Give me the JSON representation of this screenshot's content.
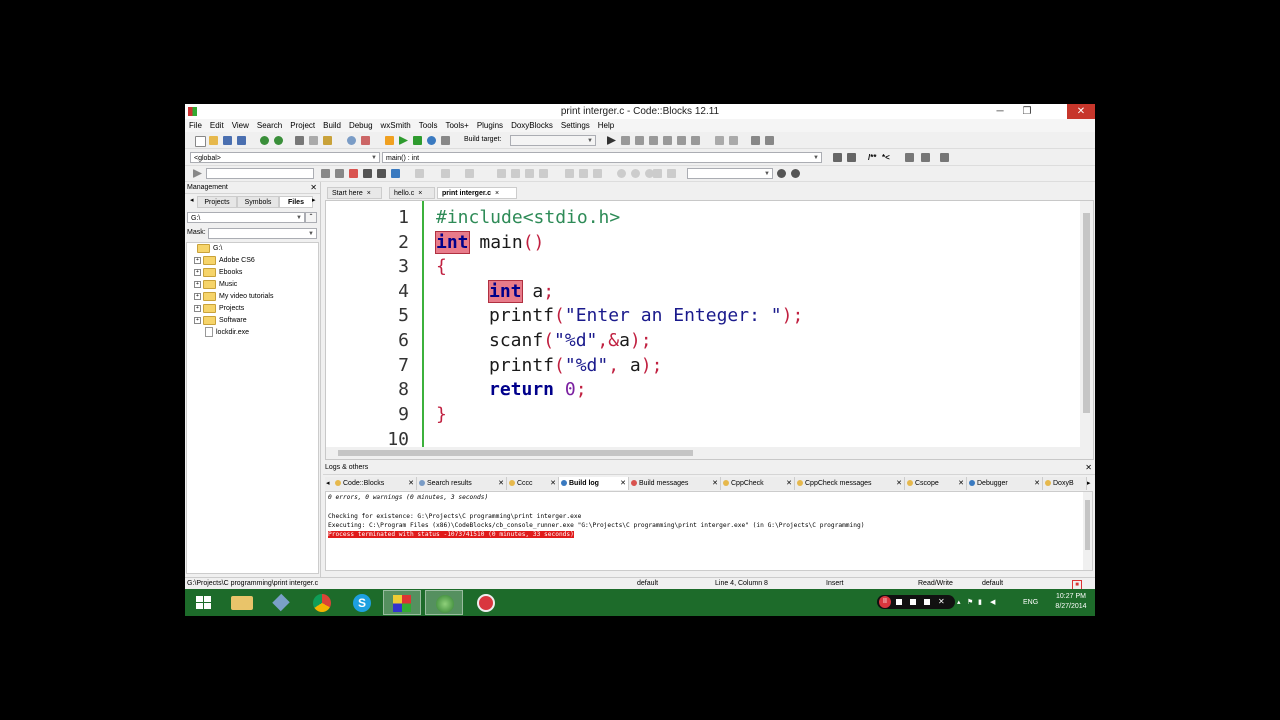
{
  "window": {
    "title": "print interger.c - Code::Blocks 12.11",
    "minimize": "─",
    "maximize": "❐",
    "close": "✕"
  },
  "menu": [
    "File",
    "Edit",
    "View",
    "Search",
    "Project",
    "Build",
    "Debug",
    "wxSmith",
    "Tools",
    "Tools+",
    "Plugins",
    "DoxyBlocks",
    "Settings",
    "Help"
  ],
  "toolbar": {
    "build_target_label": "Build target:",
    "scope_combo": "<global>",
    "function_combo": "main() : int",
    "doc_comment_btn": "/**",
    "line_comment_btn": "*<"
  },
  "management": {
    "header": "Management",
    "tabs": [
      "Projects",
      "Symbols",
      "Files"
    ],
    "drive": "G:\\",
    "mask_label": "Mask:",
    "tree": [
      {
        "label": "G:\\",
        "type": "root"
      },
      {
        "label": "Adobe CS6",
        "type": "folder"
      },
      {
        "label": "Ebooks",
        "type": "folder"
      },
      {
        "label": "Music",
        "type": "folder"
      },
      {
        "label": "My video tutorials",
        "type": "folder"
      },
      {
        "label": "Projects",
        "type": "folder"
      },
      {
        "label": "Software",
        "type": "folder"
      },
      {
        "label": "lockdir.exe",
        "type": "file"
      }
    ]
  },
  "editor": {
    "tabs": [
      "Start here",
      "hello.c",
      "print interger.c"
    ],
    "tab_close": "×",
    "line_numbers": [
      "1",
      "2",
      "3",
      "4",
      "5",
      "6",
      "7",
      "8",
      "9",
      "10"
    ],
    "code": {
      "l1": "#include<stdio.h>",
      "l2_kw": "int",
      "l2_rest": " main",
      "l2_paren": "()",
      "l3": "{",
      "l4_kw": "int",
      "l4_rest": " a",
      "l4_semi": ";",
      "l5_fn": "printf",
      "l5_open": "(",
      "l5_str": "\"Enter an Enteger: \"",
      "l5_close": ");",
      "l6_fn": "scanf",
      "l6_open": "(",
      "l6_str": "\"%d\"",
      "l6_mid": ",&",
      "l6_var": "a",
      "l6_close": ");",
      "l7_fn": "printf",
      "l7_open": "(",
      "l7_str": "\"%d\"",
      "l7_mid": ", ",
      "l7_var": "a",
      "l7_close": ");",
      "l8_kw": "return",
      "l8_num": " 0",
      "l8_semi": ";",
      "l9": "}"
    }
  },
  "logs": {
    "header": "Logs & others",
    "tabs": [
      "Code::Blocks",
      "Search results",
      "Cccc",
      "Build log",
      "Build messages",
      "CppCheck",
      "CppCheck messages",
      "Cscope",
      "Debugger",
      "DoxyB"
    ],
    "active_tab": "Build log",
    "lines": [
      "0 errors, 0 warnings (0 minutes, 3 seconds)",
      "Checking for existence: G:\\Projects\\C programming\\print interger.exe",
      "Executing: C:\\Program Files (x86)\\CodeBlocks/cb_console_runner.exe \"G:\\Projects\\C programming\\print interger.exe\"  (in G:\\Projects\\C programming)",
      "Process terminated with status -1073741510 (0 minutes, 33 seconds)"
    ]
  },
  "statusbar": {
    "path": "G:\\Projects\\C programming\\print interger.c",
    "encoding": "default",
    "position": "Line 4, Column 8",
    "mode": "Insert",
    "access": "Read/Write",
    "profile": "default"
  },
  "taskbar": {
    "language": "ENG",
    "time": "10:27 PM",
    "date": "8/27/2014",
    "accent": "#1d6b2a"
  }
}
